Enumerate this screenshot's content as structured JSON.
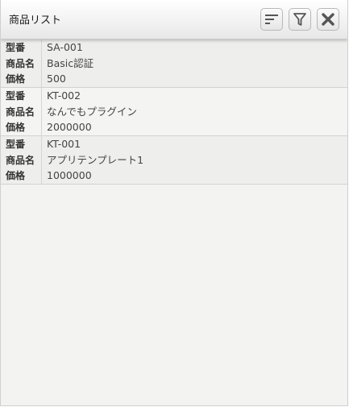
{
  "window": {
    "title": "商品リスト"
  },
  "toolbar": {
    "sort_icon": "sort-lines-icon",
    "filter_icon": "filter-funnel-icon",
    "close_icon": "close-x-icon"
  },
  "labels": {
    "model": "型番",
    "name": "商品名",
    "price": "価格"
  },
  "products": [
    {
      "model": "SA-001",
      "name": "Basic認証",
      "price": "500"
    },
    {
      "model": "KT-002",
      "name": "なんでもプラグイン",
      "price": "2000000"
    },
    {
      "model": "KT-001",
      "name": "アプリテンプレート1",
      "price": "1000000"
    }
  ]
}
